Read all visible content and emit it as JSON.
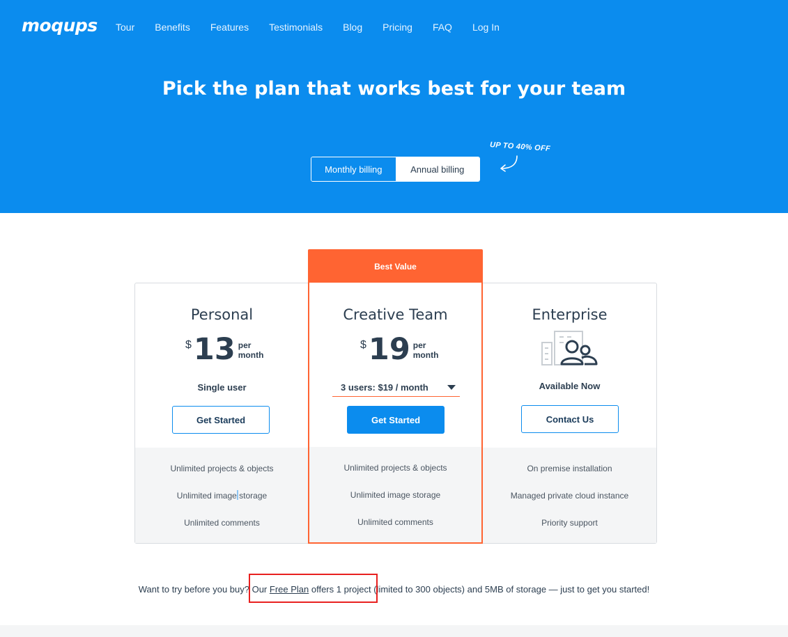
{
  "header": {
    "logo": "moqups",
    "nav": [
      "Tour",
      "Benefits",
      "Features",
      "Testimonials",
      "Blog",
      "Pricing",
      "FAQ",
      "Log In"
    ]
  },
  "hero": {
    "title": "Pick the plan that works best for your team",
    "billing": {
      "monthly": "Monthly billing",
      "annual": "Annual billing",
      "selected": "Monthly billing"
    },
    "promo": "UP TO 40% OFF"
  },
  "plans": {
    "best_value_label": "Best Value",
    "personal": {
      "name": "Personal",
      "currency": "$",
      "price": "13",
      "per": "per",
      "period": "month",
      "subtitle": "Single user",
      "button": "Get Started",
      "features": [
        "Unlimited projects & objects",
        "Unlimited image storage",
        "Unlimited comments"
      ]
    },
    "team": {
      "name": "Creative Team",
      "currency": "$",
      "price": "19",
      "per": "per",
      "period": "month",
      "users_select": "3 users: $19 / month",
      "button": "Get Started",
      "features": [
        "Unlimited projects & objects",
        "Unlimited image storage",
        "Unlimited comments"
      ]
    },
    "enterprise": {
      "name": "Enterprise",
      "icon": "enterprise-building-users-icon",
      "subtitle": "Available Now",
      "button": "Contact Us",
      "features": [
        "On premise installation",
        "Managed private cloud instance",
        "Priority support"
      ]
    }
  },
  "footer": {
    "note_before": "Want to try before you buy? Our ",
    "link": "Free Plan",
    "note_after": " offers 1 project (limited to 300 objects) and 5MB of storage — just to get you started!"
  },
  "colors": {
    "primary": "#0b8cee",
    "accent": "#ff6432",
    "text": "#2c3e50",
    "highlight": "#e8201f"
  }
}
